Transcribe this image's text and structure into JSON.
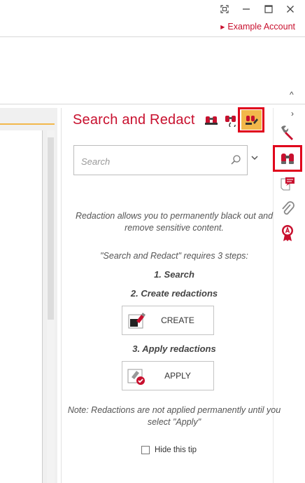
{
  "window": {
    "restore_icon": "restore-icon",
    "minimize_icon": "minimize-icon",
    "maximize_icon": "maximize-icon",
    "close_icon": "close-icon"
  },
  "account": {
    "label": "Example Account"
  },
  "panel": {
    "title": "Search and Redact",
    "search_placeholder": "Search",
    "intro": "Redaction allows you to permanently black out and remove sensitive content.",
    "steps_heading": "\"Search and Redact\" requires 3 steps:",
    "step1": "1. Search",
    "step2": "2. Create redactions",
    "create_label": "CREATE",
    "step3": "3. Apply redactions",
    "apply_label": "APPLY",
    "note": "Note: Redactions are not applied permanently until you select \"Apply\"",
    "hide_tip_label": "Hide this tip"
  },
  "colors": {
    "accent": "#c8102e",
    "highlight": "#e0001b",
    "tab_active": "#f2b84b"
  },
  "rail": {
    "icons": [
      "wrench-icon",
      "binoculars-icon",
      "comment-icon",
      "attachment-icon",
      "certificate-icon"
    ]
  }
}
